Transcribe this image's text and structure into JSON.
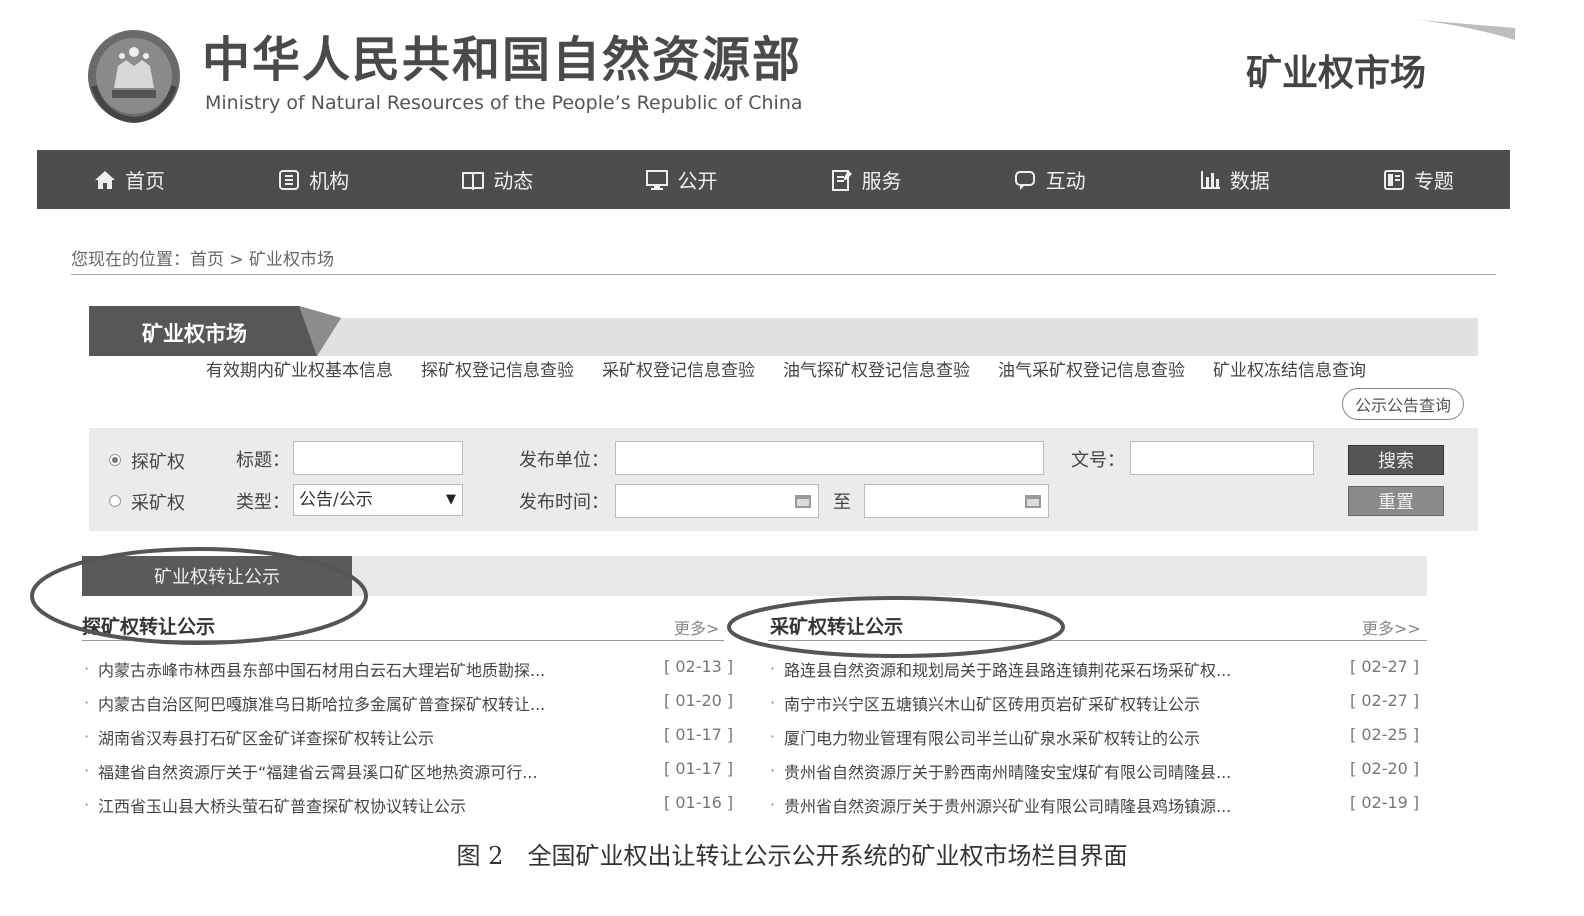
{
  "header": {
    "ministry_cn": "中华人民共和国自然资源部",
    "ministry_en": "Ministry of Natural Resources of the People’s Republic of China",
    "site_title": "矿业权市场"
  },
  "nav": [
    {
      "label": "首页",
      "icon": "home-icon"
    },
    {
      "label": "机构",
      "icon": "org-icon"
    },
    {
      "label": "动态",
      "icon": "book-icon"
    },
    {
      "label": "公开",
      "icon": "monitor-icon"
    },
    {
      "label": "服务",
      "icon": "edit-doc-icon"
    },
    {
      "label": "互动",
      "icon": "chat-icon"
    },
    {
      "label": "数据",
      "icon": "bar-chart-icon"
    },
    {
      "label": "专题",
      "icon": "folder-icon"
    }
  ],
  "breadcrumb": "您现在的位置：首页 > 矿业权市场",
  "section": {
    "title": "矿业权市场",
    "links": [
      "有效期内矿业权基本信息",
      "探矿权登记信息查验",
      "采矿权登记信息查验",
      "油气探矿权登记信息查验",
      "油气采矿权登记信息查验",
      "矿业权冻结信息查询"
    ],
    "pub_query": "公示公告查询"
  },
  "form": {
    "radio_explore": "探矿权",
    "radio_mining": "采矿权",
    "title_label": "标题：",
    "type_label": "类型：",
    "type_value": "公告/公示",
    "issuer_label": "发布单位：",
    "date_label": "发布时间：",
    "to_label": "至",
    "doc_no_label": "文号：",
    "search": "搜索",
    "reset": "重置"
  },
  "transfer": {
    "tab": "矿业权转让公示",
    "left": {
      "title": "探矿权转让公示",
      "more": "更多>",
      "items": [
        {
          "title": "内蒙古赤峰市林西县东部中国石材用白云石大理岩矿地质勘探...",
          "date": "[ 02-13 ]"
        },
        {
          "title": "内蒙古自治区阿巴嘎旗准乌日斯哈拉多金属矿普查探矿权转让...",
          "date": "[ 01-20 ]"
        },
        {
          "title": "湖南省汉寿县打石矿区金矿详查探矿权转让公示",
          "date": "[ 01-17 ]"
        },
        {
          "title": "福建省自然资源厅关于“福建省云霄县溪口矿区地热资源可行...",
          "date": "[ 01-17 ]"
        },
        {
          "title": "江西省玉山县大桥头萤石矿普查探矿权协议转让公示",
          "date": "[ 01-16 ]"
        }
      ]
    },
    "right": {
      "title": "采矿权转让公示",
      "more": "更多>>",
      "items": [
        {
          "title": "路连县自然资源和规划局关于路连县路连镇荆花采石场采矿权...",
          "date": "[ 02-27 ]"
        },
        {
          "title": "南宁市兴宁区五塘镇兴木山矿区砖用页岩矿采矿权转让公示",
          "date": "[ 02-27 ]"
        },
        {
          "title": "厦门电力物业管理有限公司半兰山矿泉水采矿权转让的公示",
          "date": "[ 02-25 ]"
        },
        {
          "title": "贵州省自然资源厅关于黔西南州晴隆安宝煤矿有限公司晴隆县...",
          "date": "[ 02-20 ]"
        },
        {
          "title": "贵州省自然资源厅关于贵州源兴矿业有限公司晴隆县鸡场镇源...",
          "date": "[ 02-19 ]"
        }
      ]
    }
  },
  "caption": "图 2　全国矿业权出让转让公示公开系统的矿业权市场栏目界面"
}
